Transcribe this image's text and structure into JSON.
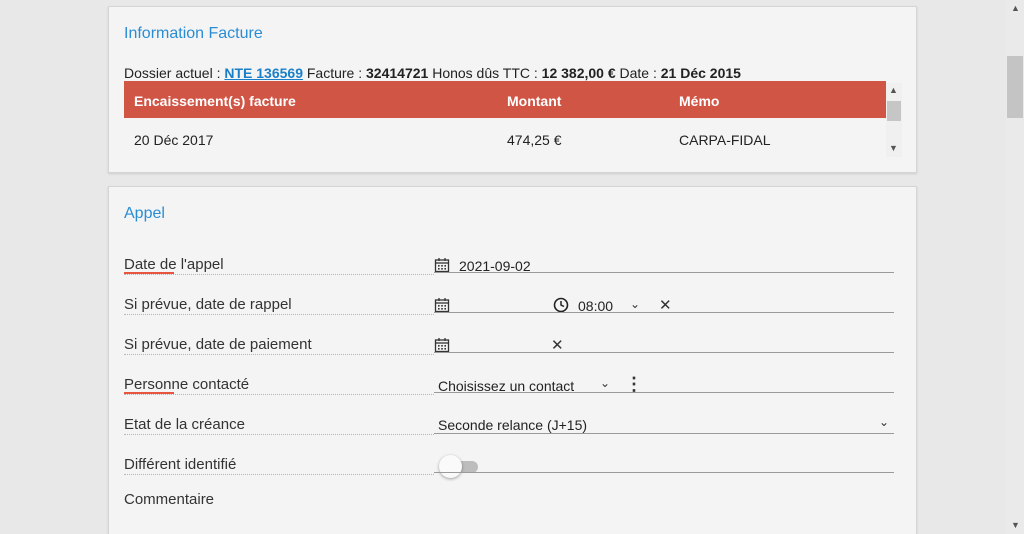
{
  "info": {
    "title": "Information Facture",
    "dossier_label": "Dossier actuel :",
    "dossier_link": "NTE 136569",
    "facture_label": "Facture :",
    "facture_value": "32414721",
    "honos_label": "Honos dûs TTC :",
    "honos_value": "12 382,00 €",
    "date_label": "Date :",
    "date_value": "21 Déc 2015",
    "table": {
      "headers": [
        "Encaissement(s) facture",
        "Montant",
        "Mémo"
      ],
      "rows": [
        [
          "20 Déc 2017",
          "474,25 €",
          "CARPA-FIDAL"
        ]
      ]
    }
  },
  "appel": {
    "title": "Appel",
    "fields": [
      {
        "label": "Date de l'appel",
        "value": "2021-09-02"
      },
      {
        "label": "Si prévue, date de rappel",
        "time": "08:00"
      },
      {
        "label": "Si prévue, date de paiement"
      },
      {
        "label": "Personne contacté",
        "value": "Choisissez un contact"
      },
      {
        "label": "Etat de la créance",
        "value": "Seconde relance (J+15)"
      },
      {
        "label": "Différent identifié",
        "toggle": false
      },
      {
        "label": "Commentaire"
      }
    ]
  },
  "icons": {
    "calendar": "calendar-icon",
    "clock": "clock-icon",
    "clear": "close-icon",
    "dropdown": "chevron-down-icon",
    "more": "more-vertical-icon"
  },
  "colors": {
    "accent": "#2a8dd4",
    "table_header": "#d05545",
    "required_underline": "#e8553e"
  }
}
